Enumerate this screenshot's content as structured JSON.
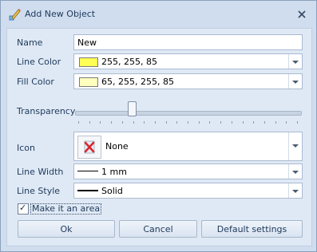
{
  "window": {
    "title": "Add New Object"
  },
  "labels": {
    "name": "Name",
    "line_color": "Line Color",
    "fill_color": "Fill Color",
    "transparency": "Transparency",
    "icon": "Icon",
    "line_width": "Line Width",
    "line_style": "Line Style"
  },
  "fields": {
    "name": "New",
    "line_color": "255, 255, 85",
    "fill_color": "65, 255, 255, 85",
    "icon": "None",
    "line_width": "1 mm",
    "line_style": "Solid"
  },
  "colors": {
    "line_swatch": "#ffff55",
    "fill_swatch": "#ffffbe"
  },
  "transparency": {
    "value": 0.25
  },
  "checkbox": {
    "label": "Make it an area",
    "checked": true
  },
  "buttons": {
    "ok": "Ok",
    "cancel": "Cancel",
    "default": "Default settings"
  },
  "icons": {
    "title": "pencil-shapes-icon",
    "close": "close-icon",
    "icon_preview": "red-x-icon"
  }
}
